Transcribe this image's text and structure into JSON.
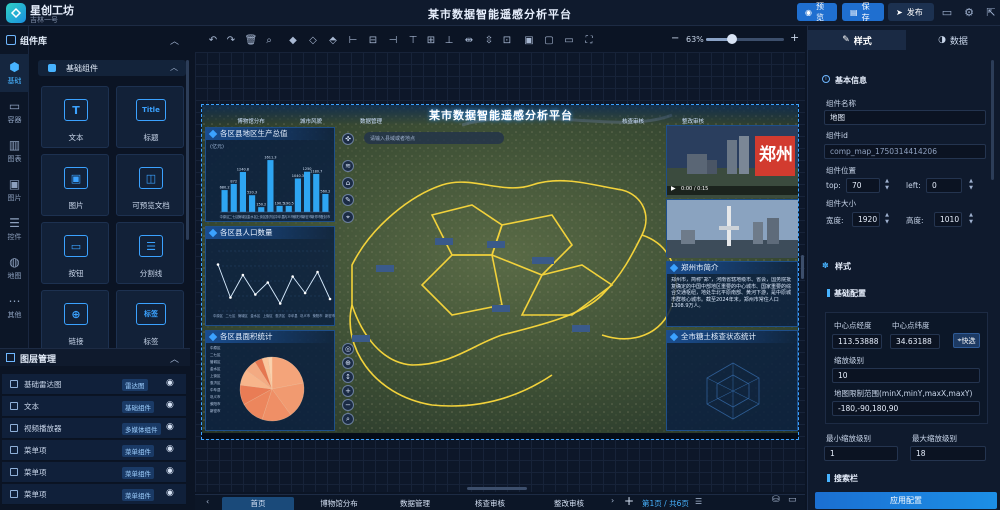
{
  "app": {
    "name": "星创工坊",
    "subtitle": "吉林一号",
    "page_title": "某市数据智能遥感分析平台"
  },
  "topbar": {
    "preview": "预览",
    "save": "保存",
    "publish": "发布"
  },
  "left_rail": [
    {
      "icon": "cube-icon",
      "label": "基础"
    },
    {
      "icon": "monitor-icon",
      "label": "容器"
    },
    {
      "icon": "chart-icon",
      "label": "图表"
    },
    {
      "icon": "image-icon",
      "label": "图片"
    },
    {
      "icon": "sliders-icon",
      "label": "控件"
    },
    {
      "icon": "globe-icon",
      "label": "地图"
    },
    {
      "icon": "more-icon",
      "label": "其他"
    }
  ],
  "library": {
    "title": "组件库",
    "group": "基础组件",
    "components": [
      {
        "icon": "T",
        "label": "文本"
      },
      {
        "icon": "Title",
        "label": "标题"
      },
      {
        "icon": "▣",
        "label": "图片"
      },
      {
        "icon": "◫",
        "label": "可预览文档"
      },
      {
        "icon": "▭",
        "label": "按钮"
      },
      {
        "icon": "☰",
        "label": "分割线"
      },
      {
        "icon": "⊕",
        "label": "链接"
      },
      {
        "icon": "标签",
        "label": "标签"
      }
    ]
  },
  "layers": {
    "title": "图层管理",
    "items": [
      {
        "name": "基础雷达图",
        "tag": "雷达图"
      },
      {
        "name": "文本",
        "tag": "基础组件"
      },
      {
        "name": "视频播放器",
        "tag": "多媒体组件"
      },
      {
        "name": "菜单项",
        "tag": "菜单组件"
      },
      {
        "name": "菜单项",
        "tag": "菜单组件"
      },
      {
        "name": "菜单项",
        "tag": "菜单组件"
      }
    ]
  },
  "zoom": {
    "label": "63%",
    "value": 0.33
  },
  "canvas": {
    "title": "某市数据智能遥感分析平台",
    "tabs": [
      "博物馆分布",
      "城市风貌",
      "数据管理",
      "",
      "核查审核",
      "整改审核"
    ],
    "search_placeholder": "请输入县域或者地点",
    "panel_gdp": "各区县地区生产总值",
    "panel_pop": "各区县人口数量",
    "panel_area": "各区县面积统计",
    "panel_city_name": "郑州",
    "panel_intro": "郑州市简介",
    "intro_text": "郑州市，简称“郑”，河南省辖地级市、省会，国务院批复确定的中国中部地区重要的中心城市、国家重要的综合交通枢纽，地处华北平原南部、黄河下游，是中原城市群核心城市。截至2024年末，郑州市常住人口1308.9万人。",
    "panel_check": "全市糖土核查状态统计",
    "video_time": "0:00 / 0:15",
    "gdp_values_label": "(亿元)"
  },
  "chart_data": [
    {
      "type": "bar",
      "title": "各区县地区生产总值",
      "ylabel": "(亿元)",
      "categories": [
        "中原区",
        "二七区",
        "管城区",
        "金水区",
        "上街区",
        "惠济区",
        "中牟县",
        "巩义市",
        "荥阳市",
        "新密市",
        "新郑市",
        "登封市"
      ],
      "values": [
        680.2,
        872.0,
        1240.8,
        520.3,
        150.2,
        1611.3,
        190.5,
        190.5,
        1040.3,
        1250.0,
        1180.7,
        560.2
      ],
      "ylim": [
        0,
        1800
      ]
    },
    {
      "type": "line",
      "title": "各区县人口数量",
      "x": [
        "中原区",
        "二七区",
        "管城区",
        "金水区",
        "上街区",
        "惠济区",
        "中牟县",
        "巩义市",
        "荥阳市",
        "新密市"
      ],
      "values": [
        62,
        18,
        48,
        22,
        38,
        10,
        46,
        24,
        52,
        16
      ],
      "ylim": [
        0,
        80
      ]
    },
    {
      "type": "pie",
      "title": "各区县面积统计",
      "categories": [
        "中原区",
        "二七区",
        "管城区",
        "金水区",
        "上街区",
        "惠济区",
        "中牟县",
        "巩义市",
        "荥阳市",
        "新密市"
      ],
      "values": [
        22,
        18,
        15,
        12,
        10,
        8,
        6,
        4,
        3,
        2
      ]
    }
  ],
  "right": {
    "tab_style": "样式",
    "tab_data": "数据",
    "basic_info": "基本信息",
    "name_label": "组件名称",
    "name_value": "地图",
    "id_label": "组件id",
    "id_value": "comp_map_1750314414206",
    "pos_label": "组件位置",
    "top_label": "top:",
    "top_value": "70",
    "left_label": "left:",
    "left_value": "0",
    "size_label": "组件大小",
    "width_label": "宽度:",
    "width_value": "1920",
    "height_label": "高度:",
    "height_value": "1010",
    "style_section": "样式",
    "basic_config": "基础配置",
    "center_lon_label": "中心点经度",
    "center_lat_label": "中心点纬度",
    "center_lon": "113.53888",
    "center_lat": "34.63188",
    "quick_select": "快选",
    "zoom_label": "缩放级别",
    "zoom_value": "10",
    "bounds_label": "地图限制范围(minX,minY,maxX,maxY)",
    "bounds_value": "-180,-90,180,90",
    "min_zoom_label": "最小缩放级别",
    "min_zoom": "1",
    "max_zoom_label": "最大缩放级别",
    "max_zoom": "18",
    "search_section": "搜索栏",
    "apply": "应用配置"
  },
  "page_tabs": [
    "首页",
    "博物馆分布",
    "数据管理",
    "核查审核",
    "整改审核"
  ],
  "page_counter": "第1页 / 共6页"
}
